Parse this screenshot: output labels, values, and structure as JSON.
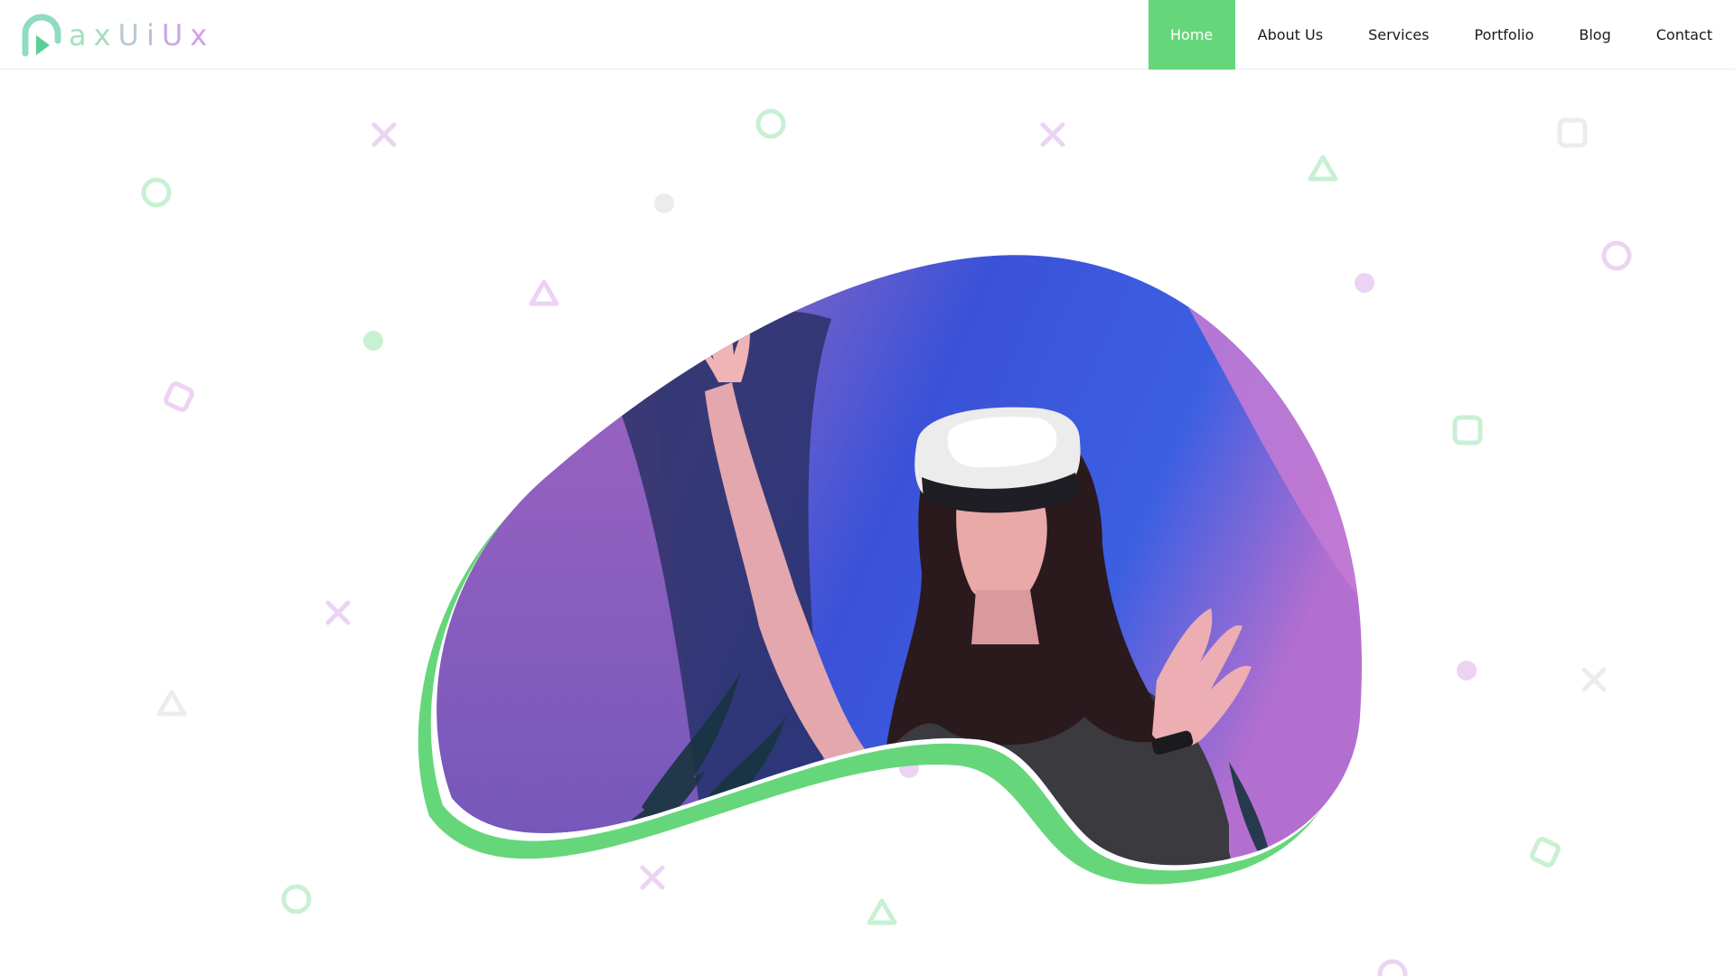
{
  "brand": {
    "logo_letters": [
      "a",
      "x",
      "U",
      "i",
      "U",
      "x"
    ],
    "logo_colors": [
      "#9fe3bd",
      "#a8d9c2",
      "#b7c9d6",
      "#c4b6e3",
      "#c9a7e6",
      "#d39ee8"
    ]
  },
  "nav": {
    "items": [
      {
        "label": "Home",
        "active": true
      },
      {
        "label": "About Us",
        "active": false
      },
      {
        "label": "Services",
        "active": false
      },
      {
        "label": "Portfolio",
        "active": false
      },
      {
        "label": "Blog",
        "active": false
      },
      {
        "label": "Contact",
        "active": false
      }
    ]
  },
  "colors": {
    "accent_green": "#66d67a",
    "decor_green": "#c8f0d3",
    "decor_purple": "#ecd3f3",
    "decor_gray": "#ececec"
  },
  "hero": {
    "image_subject": "woman-wearing-vr-headset"
  }
}
